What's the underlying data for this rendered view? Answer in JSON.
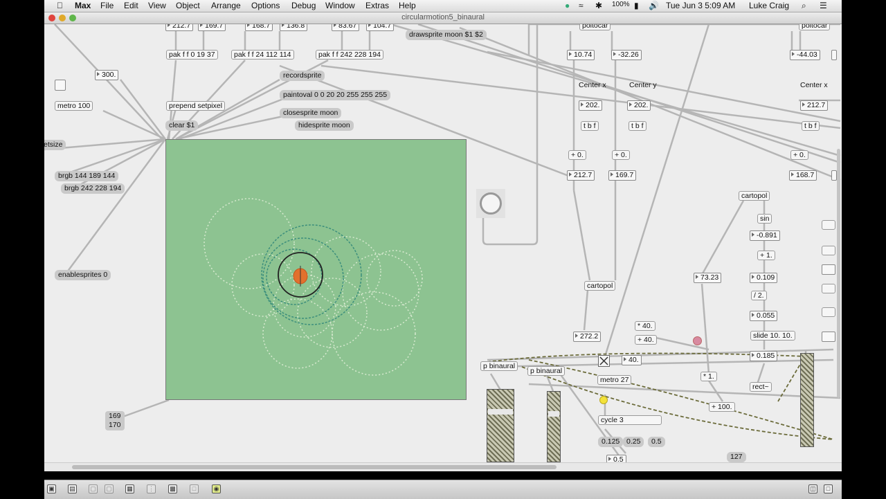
{
  "menubar": {
    "apple": "",
    "app": "Max",
    "items": [
      "File",
      "Edit",
      "View",
      "Object",
      "Arrange",
      "Options",
      "Debug",
      "Window",
      "Extras",
      "Help"
    ],
    "battery": "100%",
    "clock": "Tue Jun 3  5:09 AM",
    "user": "Luke Craig"
  },
  "window": {
    "title": "circularmotion5_binaural"
  },
  "objects": {
    "pak1": "pak f f 0 19 37",
    "pak2": "pak f f 24 112 114",
    "pak3": "pak f f 242 228 194",
    "metro100": "metro 100",
    "prepend": "prepend setpixel",
    "tbf1": "t b f",
    "tbf2": "t b f",
    "tbf3": "t b f",
    "plus0a": "+ 0.",
    "plus0b": "+ 0.",
    "plus0c": "+ 0.",
    "poltocar1": "poltocar",
    "poltocar2": "poltocar",
    "cartopol1": "cartopol",
    "cartopol2": "cartopol",
    "sin": "sin",
    "plus1": "+ 1.",
    "div2": "/ 2.",
    "slide": "slide 10. 10.",
    "rect": "rect~",
    "mul1": "* 1.",
    "plus100": "+ 100.",
    "pbin1": "p binaural",
    "pbin2": "p binaural",
    "metro27": "metro 27",
    "cycle3": "cycle 3",
    "mul40": "* 40.",
    "plus40": "+ 40."
  },
  "messages": {
    "drawsprite": "drawsprite moon $1 $2",
    "recordsprite": "recordsprite",
    "paintoval": "paintoval 0 0 20 20 255 255 255",
    "closesprite": "closesprite moon",
    "hidesprite": "hidesprite moon",
    "clear": "clear $1",
    "setsize": "etsize",
    "brgb1": "brgb 144 189 144",
    "brgb2": "brgb 242 228 194",
    "enablesprites": "enablesprites 0",
    "m0125": "0.125",
    "m025": "0.25",
    "m05": "0.5",
    "list1": "169",
    "list2": "170",
    "m127": "127"
  },
  "numbers": {
    "n300": "300.",
    "n1074": "10.74",
    "nneg3226": "-32.26",
    "nneg4403": "-44.03",
    "cx": "202.",
    "cy": "202.",
    "cx2": "212.7",
    "r2127": "212.7",
    "r1697": "169.7",
    "r1687": "168.7",
    "n2722": "272.2",
    "n7323": "73.23",
    "nneg0891": "-0.891",
    "n0109": "0.109",
    "n0055": "0.055",
    "n0185": "0.185",
    "n40": "40.",
    "n05b": "0.5",
    "top1": "212.7",
    "top2": "169.7",
    "top3": "168.7",
    "top4": "136.8",
    "top5": "83.67",
    "top6": "104.7"
  },
  "labels": {
    "centerx": "Center x",
    "centery": "Center y",
    "centerx2": "Center x"
  },
  "colors": {
    "lcd_bg": "#8dc391",
    "canvas_bg": "#ededed",
    "patchcord": "#b5b5b5",
    "signal_cord": "#6b6b3a",
    "toggle_on": "#f3e23a",
    "pink_led": "#d88aa0"
  }
}
